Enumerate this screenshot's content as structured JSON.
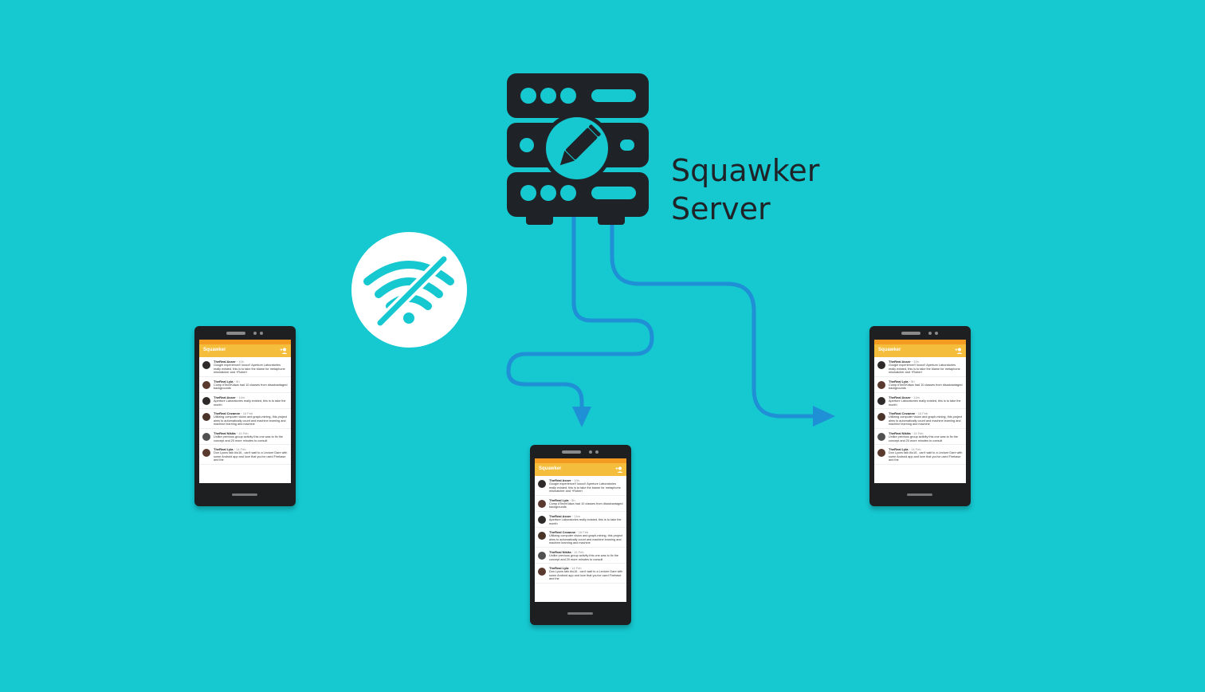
{
  "server": {
    "label_line1": "Squawker",
    "label_line2": "Server",
    "icon": "server-rack-with-pencil-icon"
  },
  "offline_icon": "wifi-off-icon",
  "colors": {
    "background": "#16c8d0",
    "server": "#1f2327",
    "arrow": "#1f8fd6",
    "app_bar": "#f5bd3c",
    "status_bar": "#f29b20"
  },
  "app": {
    "title": "Squawker",
    "add_icon": "person-add-icon",
    "messages": [
      {
        "author": "TheReal Asser",
        "date": "10h",
        "text": "Google experience!! loooo!! Aperture Laboratories really existed, this is to take the blame for metaphone mismatcher and +Robert"
      },
      {
        "author": "TheReal Lyla",
        "date": "5h",
        "text": "Comp #TechKidwa had 10 classes from disadvantaged backgrounds"
      },
      {
        "author": "TheReal Asser",
        "date": "14m",
        "text": "Aperture Laboratories really existed, this is to take the month"
      },
      {
        "author": "TheReal Cezanne",
        "date": "16 Feb",
        "text": "Utilizing computer vision and graph-mining, this project aims to automatically count and machine learning and machine learning and machine"
      },
      {
        "author": "TheReal Nikita",
        "date": "15 Feb",
        "text": "Unlike previous group activity this one was to fix the concept and 20 more minutes to consult"
      },
      {
        "author": "TheReal Lyla",
        "date": "14 Feb",
        "text": "Don Lyons talk #io16 , can't wait to a Lecture Dare with some Android app and love that you've used Firebase and the"
      }
    ]
  }
}
